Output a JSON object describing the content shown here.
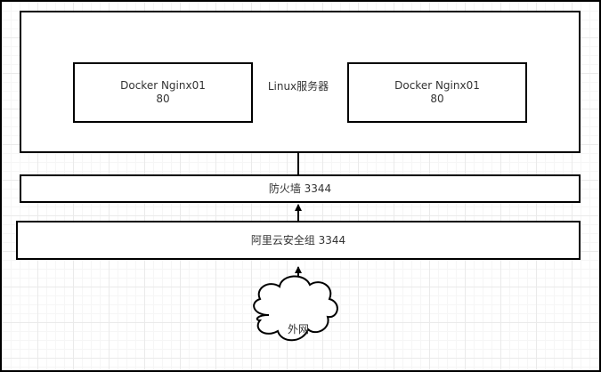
{
  "server": {
    "label": "Linux服务器"
  },
  "containers": [
    {
      "name": "Docker Nginx01",
      "port": "80"
    },
    {
      "name": "Docker Nginx01",
      "port": "80"
    }
  ],
  "firewall": {
    "label": "防火墙 3344"
  },
  "security_group": {
    "label": "阿里云安全组 3344"
  },
  "internet": {
    "label": "外网"
  },
  "colors": {
    "stroke": "#000000",
    "text": "#333333",
    "grid": "#eaeaea",
    "fill": "#ffffff"
  }
}
